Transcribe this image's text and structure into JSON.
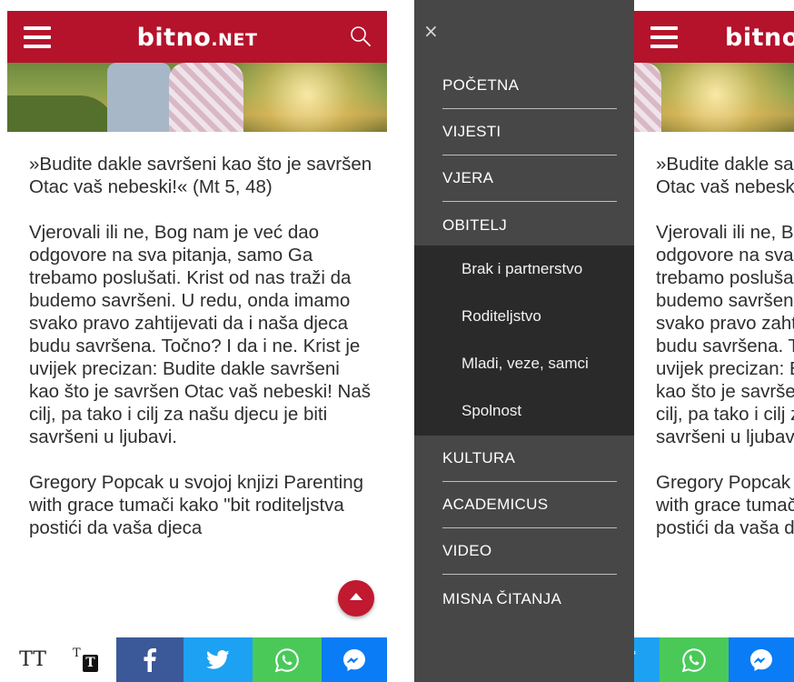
{
  "header": {
    "logo_main": "bitno",
    "logo_suffix": ".NET"
  },
  "article": {
    "paragraphs": [
      "»Budite dakle savršeni kao što je savršen Otac vaš nebeski!« (Mt 5, 48)",
      "Vjerovali ili ne, Bog nam je već dao odgovore na sva pitanja, samo Ga trebamo poslušati. Krist od nas traži da budemo savršeni. U redu, onda imamo svako pravo zahtijevati da i naša djeca budu savršena. Točno? I da i ne. Krist je uvijek precizan: Budite dakle savršeni kao što je savršen Otac vaš nebeski! Naš cilj, pa tako i cilj za našu djecu je biti savršeni u ljubavi.",
      "Gregory Popcak u svojoj knjizi Parenting with grace tumači kako \"bit roditeljstva postići da vaša djeca"
    ]
  },
  "share_bar": {
    "text_size_label": "TT",
    "text_size_alt_label": "T",
    "text_size_alt_box": "T"
  },
  "menu": {
    "close_label": "×",
    "items": [
      "POČETNA",
      "VIJESTI",
      "VJERA",
      "OBITELJ",
      "KULTURA",
      "ACADEMICUS",
      "VIDEO",
      "MISNA ČITANJA"
    ],
    "submenu": [
      "Brak i partnerstvo",
      "Roditeljstvo",
      "Mladi, veze, samci",
      "Spolnost"
    ]
  },
  "colors": {
    "header_red": "#b5122b",
    "menu_bg": "#474747",
    "submenu_bg": "#2a2a2a",
    "facebook": "#3b5998",
    "twitter": "#1da1f2",
    "whatsapp": "#4ac959",
    "messenger": "#0a7cf6"
  },
  "icons": [
    "hamburger-icon",
    "search-icon",
    "scroll-top-icon",
    "facebook-icon",
    "twitter-icon",
    "whatsapp-icon",
    "messenger-icon",
    "close-icon"
  ]
}
